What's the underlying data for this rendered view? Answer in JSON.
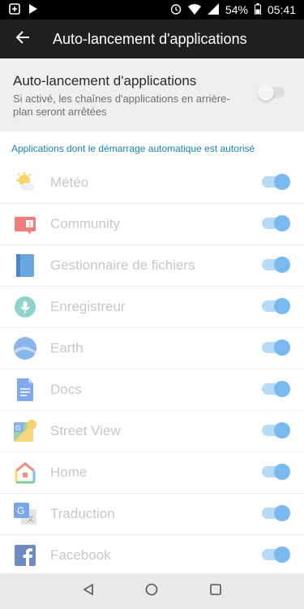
{
  "status_bar": {
    "battery_percent": "54%",
    "time": "05:41",
    "icons": [
      "alarm-icon",
      "wifi-icon",
      "signal-icon",
      "battery-icon",
      "notification-icon"
    ]
  },
  "appbar": {
    "title": "Auto-lancement d'applications",
    "back_icon": "back-arrow-icon"
  },
  "setting": {
    "title": "Auto-lancement d'applications",
    "description": "Si activé, les chaînes d'applications en arrière-plan seront arrêtées",
    "enabled": false
  },
  "section_header": "Applications dont le démarrage automatique est autorisé",
  "apps": [
    {
      "label": "Météo",
      "icon": "weather-icon",
      "enabled": true
    },
    {
      "label": "Community",
      "icon": "community-icon",
      "enabled": true
    },
    {
      "label": "Gestionnaire de fichiers",
      "icon": "file-manager-icon",
      "enabled": true
    },
    {
      "label": "Enregistreur",
      "icon": "recorder-icon",
      "enabled": true
    },
    {
      "label": "Earth",
      "icon": "earth-icon",
      "enabled": true
    },
    {
      "label": "Docs",
      "icon": "docs-icon",
      "enabled": true
    },
    {
      "label": "Street View",
      "icon": "street-view-icon",
      "enabled": true
    },
    {
      "label": "Home",
      "icon": "home-icon",
      "enabled": true
    },
    {
      "label": "Traduction",
      "icon": "translate-icon",
      "enabled": true
    },
    {
      "label": "Facebook",
      "icon": "facebook-icon",
      "enabled": true
    }
  ],
  "colors": {
    "accent": "#1b86a3",
    "toggle_on": "#78b9ef",
    "appbar": "#202020"
  }
}
